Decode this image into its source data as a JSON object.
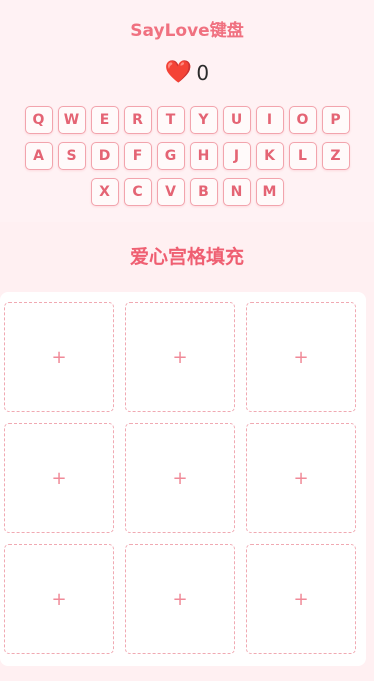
{
  "header": {
    "title": "SayLove键盘",
    "heart_symbol": "❤️",
    "love_count": "0"
  },
  "keyboard": {
    "rows": [
      [
        "Q",
        "W",
        "E",
        "R",
        "T",
        "Y",
        "U",
        "I",
        "O",
        "P"
      ],
      [
        "A",
        "S",
        "D",
        "F",
        "G",
        "H",
        "J",
        "K",
        "L",
        "Z"
      ],
      [
        "X",
        "C",
        "V",
        "B",
        "N",
        "M"
      ]
    ]
  },
  "grid": {
    "title": "爱心宫格填充",
    "plus_symbol": "+",
    "cells": 9
  },
  "colors": {
    "accent": "#f07180",
    "key_border": "#f2a4ad",
    "heart": "#e0282e"
  }
}
